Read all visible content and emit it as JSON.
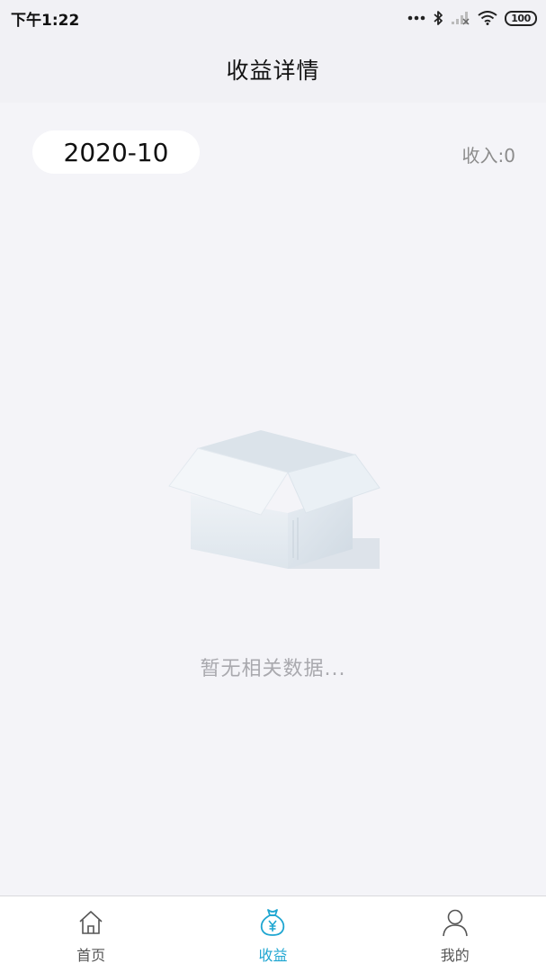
{
  "status_bar": {
    "time": "下午1:22",
    "battery": "100"
  },
  "header": {
    "title": "收益详情"
  },
  "filter": {
    "month": "2020-10",
    "income_label": "收入:",
    "income_value": "0"
  },
  "empty_state": {
    "message": "暂无相关数据..."
  },
  "bottom_nav": {
    "items": [
      {
        "label": "首页",
        "icon": "home-icon",
        "active": false
      },
      {
        "label": "收益",
        "icon": "money-bag-icon",
        "active": true
      },
      {
        "label": "我的",
        "icon": "person-icon",
        "active": false
      }
    ]
  },
  "colors": {
    "accent": "#1fa6d1",
    "background": "#f4f4f8",
    "header": "#f1f1f5"
  }
}
